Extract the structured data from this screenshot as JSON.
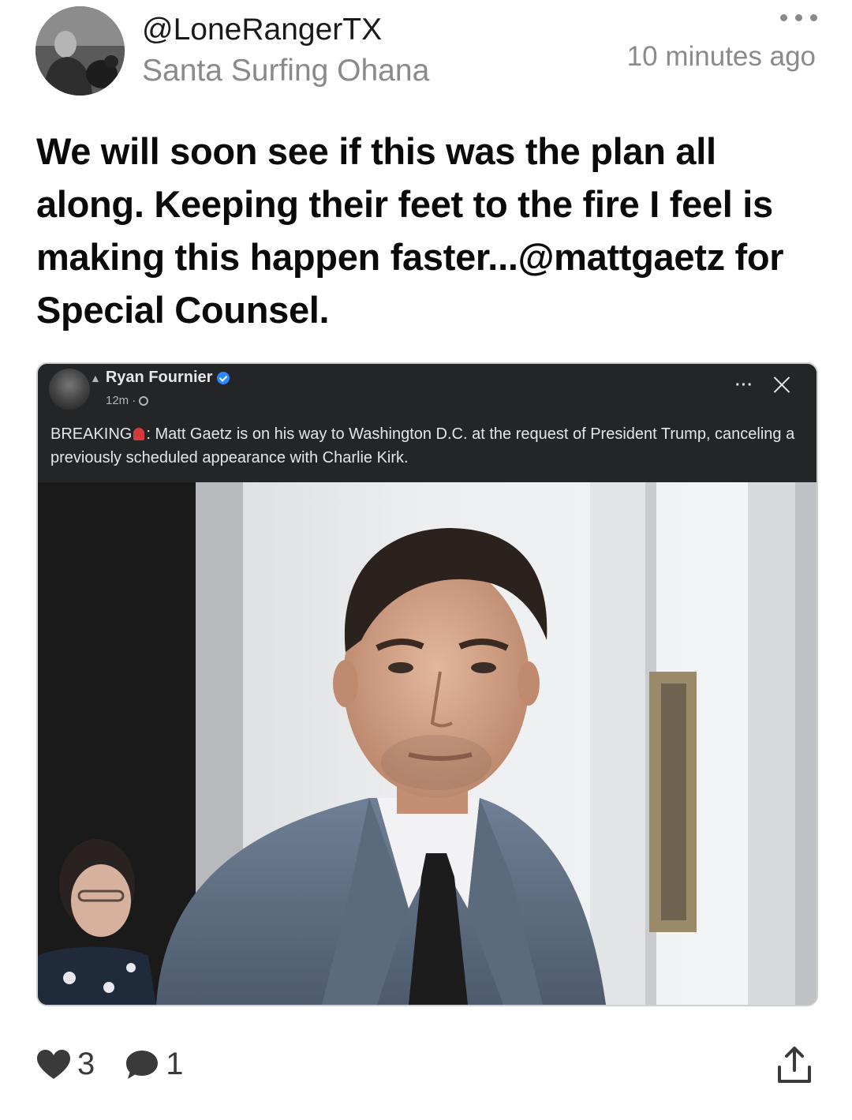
{
  "post": {
    "handle": "@LoneRangerTX",
    "community": "Santa Surfing Ohana",
    "time": "10 minutes ago",
    "text": "We will soon see if this was the plan all along. Keeping their feet to the fire I feel is making this happen faster...@mattgaetz for Special Counsel."
  },
  "embed": {
    "author": "Ryan Fournier",
    "age": "12m",
    "dots": "···",
    "breaking_label": "BREAKING",
    "breaking_text": ": Matt Gaetz is on his way to Washington D.C. at the request of President Trump, canceling a previously scheduled appearance with Charlie Kirk."
  },
  "actions": {
    "likes": "3",
    "comments": "1"
  },
  "icons": {
    "like": "heart-icon",
    "comment": "comment-bubble-icon",
    "share": "share-icon",
    "more": "more-dots-icon"
  }
}
